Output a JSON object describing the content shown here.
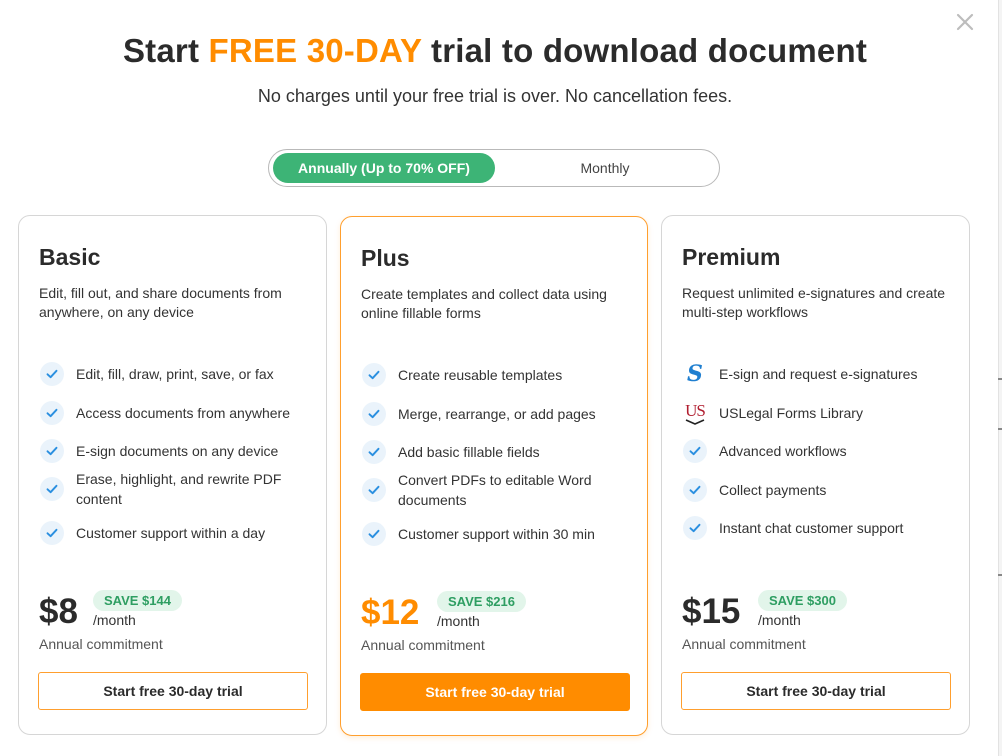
{
  "header": {
    "title_prefix": "Start ",
    "title_highlight": "FREE 30-DAY",
    "title_suffix": " trial to download document",
    "subtitle": "No charges until your free trial is over. No cancellation fees.",
    "close_icon": "close-icon"
  },
  "billing_toggle": {
    "selected": "annually",
    "annually_label": "Annually (Up to 70% OFF)",
    "monthly_label": "Monthly"
  },
  "colors": {
    "accent": "#ff8c00",
    "toggle_active": "#3db476",
    "check": "#2a8fe0",
    "save_badge_bg": "#e2f5ea",
    "save_badge_text": "#2e9e62"
  },
  "plans": [
    {
      "name": "Basic",
      "description": "Edit, fill out, and share documents from anywhere, on any device",
      "features": [
        {
          "icon": "check-icon",
          "text": "Edit, fill, draw, print, save, or fax"
        },
        {
          "icon": "check-icon",
          "text": "Access documents from anywhere"
        },
        {
          "icon": "check-icon",
          "text": "E-sign documents on any device"
        },
        {
          "icon": "check-icon",
          "text": "Erase, highlight, and rewrite PDF content"
        },
        {
          "icon": "check-icon",
          "text": "Customer support within a day"
        }
      ],
      "price": "$8",
      "per": "/month",
      "save": "SAVE $144",
      "commitment": "Annual commitment",
      "cta": "Start free 30-day trial"
    },
    {
      "name": "Plus",
      "description": "Create templates and collect data using online fillable forms",
      "features": [
        {
          "icon": "check-icon",
          "text": "Create reusable templates"
        },
        {
          "icon": "check-icon",
          "text": "Merge, rearrange, or add pages"
        },
        {
          "icon": "check-icon",
          "text": "Add basic fillable fields"
        },
        {
          "icon": "check-icon",
          "text": "Convert PDFs to editable Word documents"
        },
        {
          "icon": "check-icon",
          "text": "Customer support within 30 min"
        }
      ],
      "price": "$12",
      "per": "/month",
      "save": "SAVE $216",
      "commitment": "Annual commitment",
      "cta": "Start free 30-day trial"
    },
    {
      "name": "Premium",
      "description": "Request unlimited e-signatures and create multi-step workflows",
      "features": [
        {
          "icon": "esign-icon",
          "text": "E-sign and request e-signatures"
        },
        {
          "icon": "uslegal-logo-icon",
          "text": "USLegal Forms Library",
          "logo_text": "US"
        },
        {
          "icon": "check-icon",
          "text": "Advanced workflows"
        },
        {
          "icon": "check-icon",
          "text": "Collect payments"
        },
        {
          "icon": "check-icon",
          "text": "Instant chat customer support"
        }
      ],
      "price": "$15",
      "per": "/month",
      "save": "SAVE $300",
      "commitment": "Annual commitment",
      "cta": "Start free 30-day trial"
    }
  ]
}
